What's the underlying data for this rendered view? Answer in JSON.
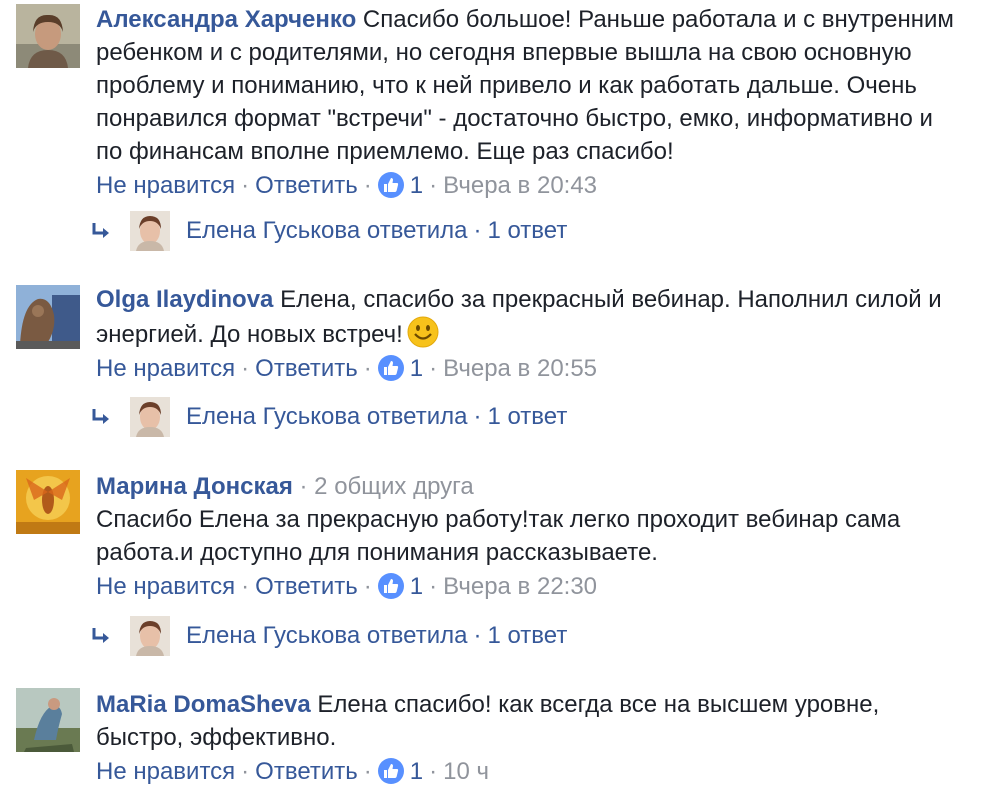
{
  "actions": {
    "unlike": "Не нравится",
    "reply": "Ответить"
  },
  "reply_label": "Елена Гуськова ответила",
  "reply_count": "1 ответ",
  "comments": [
    {
      "author": "Александра Харченко",
      "text": "Спасибо большое! Раньше работала и с внутренним ребенком и с родителями, но сегодня впервые вышла на свою основную проблему и пониманию, что к ней привело и как работать дальше. Очень понравился формат \"встречи\" - достаточно быстро, емко, информативно и по финансам вполне приемлемо. Еще раз спасибо!",
      "likes": "1",
      "time": "Вчера в 20:43"
    },
    {
      "author": "Olga Ilaydinova",
      "text": "Елена, спасибо за прекрасный вебинар. Наполнил силой и энергией. До новых встреч!",
      "likes": "1",
      "time": "Вчера в 20:55"
    },
    {
      "author": "Марина Донская",
      "mutual": "2 общих друга",
      "text": "Спасибо Елена за прекрасную работу!так легко проходит вебинар сама работа.и доступно для понимания рассказываете.",
      "likes": "1",
      "time": "Вчера в 22:30"
    },
    {
      "author": "MaRia DomaSheva",
      "text": "Елена спасибо! как всегда все на высшем уровне, быстро, эффективно.",
      "likes": "1",
      "time": "10 ч"
    }
  ],
  "colors": {
    "link": "#365899",
    "meta": "#90949c",
    "text": "#1d2129",
    "like": "#5890ff"
  }
}
